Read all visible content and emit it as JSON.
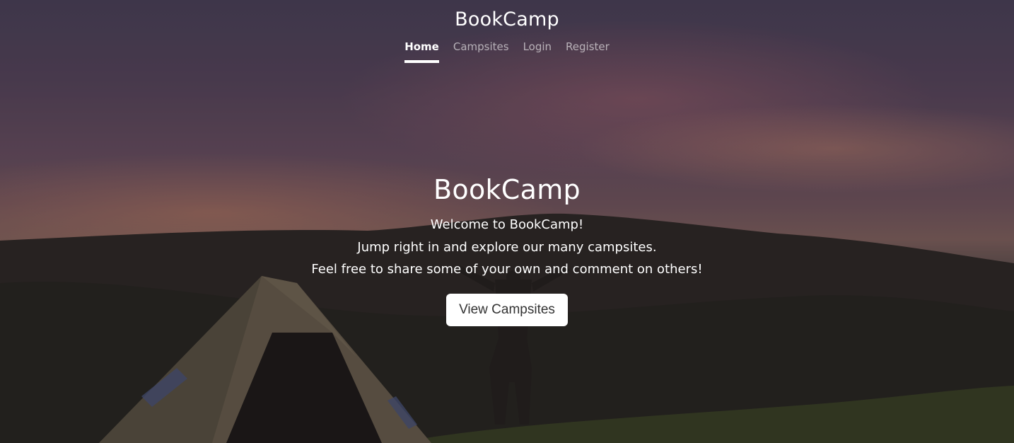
{
  "header": {
    "brand": "BookCamp",
    "nav": [
      {
        "label": "Home",
        "active": true
      },
      {
        "label": "Campsites",
        "active": false
      },
      {
        "label": "Login",
        "active": false
      },
      {
        "label": "Register",
        "active": false
      }
    ]
  },
  "hero": {
    "title": "BookCamp",
    "lines": [
      "Welcome to BookCamp!",
      "Jump right in and explore our many campsites.",
      "Feel free to share some of your own and comment on others!"
    ],
    "button_label": "View Campsites"
  },
  "colors": {
    "text": "#ffffff",
    "button_bg": "#ffffff",
    "button_text": "#333333"
  }
}
